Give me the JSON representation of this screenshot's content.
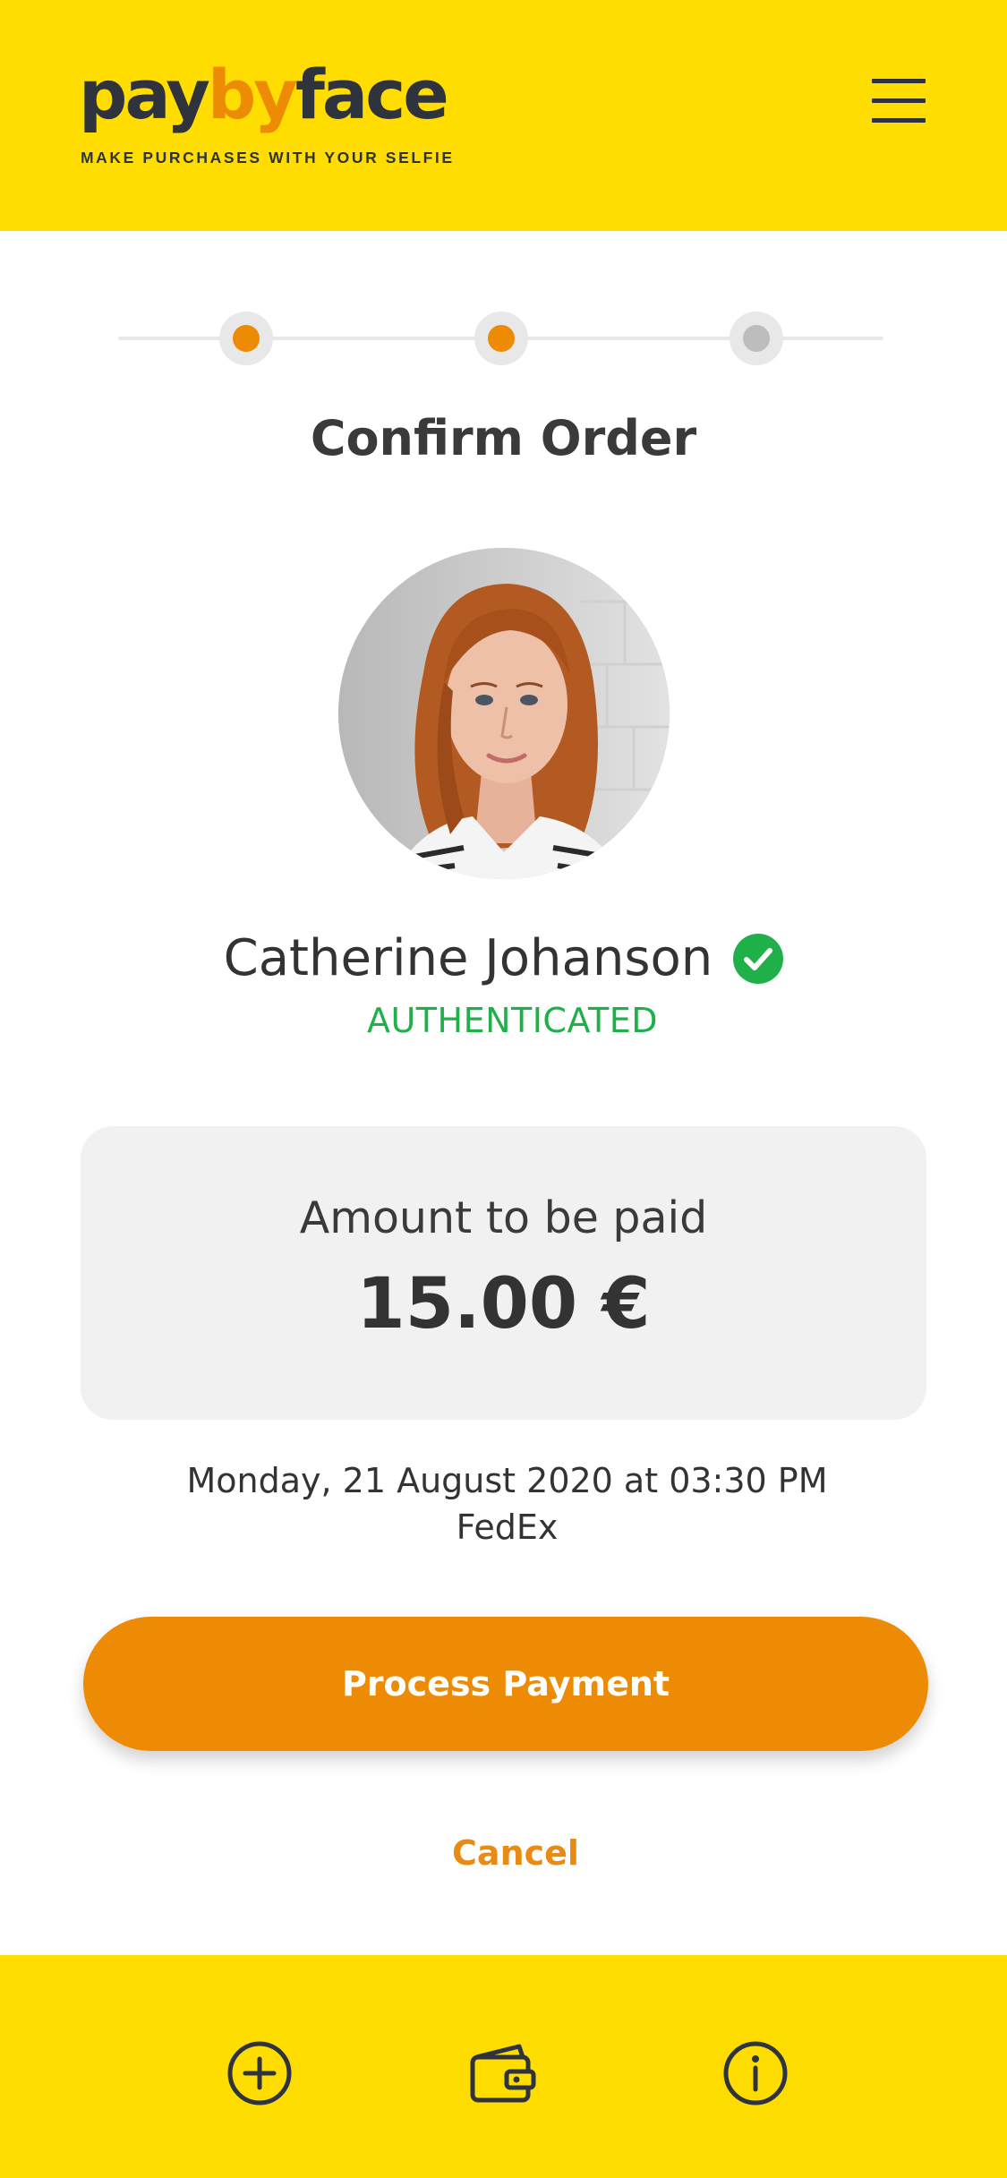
{
  "header": {
    "logo": {
      "part1": "pay",
      "part2": "by",
      "part3": "face"
    },
    "tagline": "MAKE PURCHASES WITH YOUR SELFIE",
    "menu_icon": "hamburger-menu-icon"
  },
  "stepper": {
    "steps": [
      {
        "state": "complete"
      },
      {
        "state": "current"
      },
      {
        "state": "pending"
      }
    ]
  },
  "page": {
    "title": "Confirm Order"
  },
  "user": {
    "name": "Catherine Johanson",
    "status": "AUTHENTICATED",
    "verified_icon": "check-circle-icon"
  },
  "amount": {
    "label": "Amount to be paid",
    "value": "15.00 €"
  },
  "delivery": {
    "datetime": "Monday, 21 August 2020 at 03:30 PM",
    "carrier": "FedEx"
  },
  "actions": {
    "primary": "Process Payment",
    "secondary": "Cancel"
  },
  "bottom_nav": {
    "items": [
      {
        "icon": "plus-circle-icon"
      },
      {
        "icon": "wallet-icon"
      },
      {
        "icon": "info-circle-icon"
      }
    ]
  },
  "colors": {
    "brand_yellow": "#FFDD00",
    "accent_orange": "#EE8B05",
    "dark": "#2E333D",
    "success_green": "#20B04A",
    "card_gray": "#F1F1F1"
  }
}
